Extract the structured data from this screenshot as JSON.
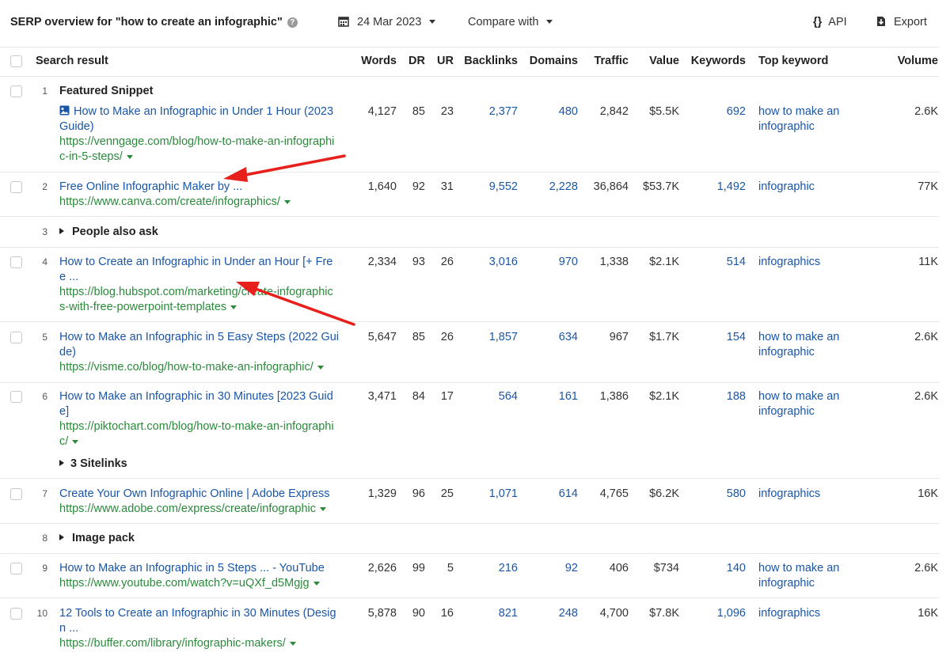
{
  "header": {
    "title": "SERP overview for \"how to create an infographic\"",
    "help_icon": "?",
    "date": "24 Mar 2023",
    "compare": "Compare with",
    "api": "API",
    "export": "Export"
  },
  "columns": {
    "search_result": "Search result",
    "words": "Words",
    "dr": "DR",
    "ur": "UR",
    "backlinks": "Backlinks",
    "domains": "Domains",
    "traffic": "Traffic",
    "value": "Value",
    "keywords": "Keywords",
    "top_keyword": "Top keyword",
    "volume": "Volume"
  },
  "rows": [
    {
      "rank": "1",
      "label": "Featured Snippet",
      "title1": "How to Make an Infographic in Under 1 Hour (2023",
      "title2": "Guide)",
      "url1": "https://venngage.com/blog/how-to-make-an-infographi",
      "url2": "c-in-5-steps/",
      "words": "4,127",
      "dr": "85",
      "ur": "23",
      "backlinks": "2,377",
      "domains": "480",
      "traffic": "2,842",
      "value": "$5.5K",
      "keywords": "692",
      "kw1": "how to make an",
      "kw2": "infographic",
      "volume": "2.6K"
    },
    {
      "rank": "2",
      "title1": "Free Online Infographic Maker by ...",
      "url1": "https://www.canva.com/create/infographics/",
      "words": "1,640",
      "dr": "92",
      "ur": "31",
      "backlinks": "9,552",
      "domains": "2,228",
      "traffic": "36,864",
      "value": "$53.7K",
      "keywords": "1,492",
      "kw1": "infographic",
      "volume": "77K"
    },
    {
      "rank": "3",
      "label": "People also ask"
    },
    {
      "rank": "4",
      "title1": "How to Create an Infographic in Under an Hour [+ Fre",
      "title2": "e ...",
      "url1": "https://blog.hubspot.com/marketing/create-infographic",
      "url2": "s-with-free-powerpoint-templates",
      "words": "2,334",
      "dr": "93",
      "ur": "26",
      "backlinks": "3,016",
      "domains": "970",
      "traffic": "1,338",
      "value": "$2.1K",
      "keywords": "514",
      "kw1": "infographics",
      "volume": "11K"
    },
    {
      "rank": "5",
      "title1": "How to Make an Infographic in 5 Easy Steps (2022 Gui",
      "title2": "de)",
      "url1": "https://visme.co/blog/how-to-make-an-infographic/",
      "words": "5,647",
      "dr": "85",
      "ur": "26",
      "backlinks": "1,857",
      "domains": "634",
      "traffic": "967",
      "value": "$1.7K",
      "keywords": "154",
      "kw1": "how to make an",
      "kw2": "infographic",
      "volume": "2.6K"
    },
    {
      "rank": "6",
      "title1": "How to Make an Infographic in 30 Minutes [2023 Guid",
      "title2": "e]",
      "url1": "https://piktochart.com/blog/how-to-make-an-infographi",
      "url2": "c/",
      "sitelinks": "3 Sitelinks",
      "words": "3,471",
      "dr": "84",
      "ur": "17",
      "backlinks": "564",
      "domains": "161",
      "traffic": "1,386",
      "value": "$2.1K",
      "keywords": "188",
      "kw1": "how to make an",
      "kw2": "infographic",
      "volume": "2.6K"
    },
    {
      "rank": "7",
      "title1": "Create Your Own Infographic Online | Adobe Express",
      "url1": "https://www.adobe.com/express/create/infographic",
      "words": "1,329",
      "dr": "96",
      "ur": "25",
      "backlinks": "1,071",
      "domains": "614",
      "traffic": "4,765",
      "value": "$6.2K",
      "keywords": "580",
      "kw1": "infographics",
      "volume": "16K"
    },
    {
      "rank": "8",
      "label": "Image pack"
    },
    {
      "rank": "9",
      "title1": "How to Make an Infographic in 5 Steps ... - YouTube",
      "url1": "https://www.youtube.com/watch?v=uQXf_d5Mgjg",
      "words": "2,626",
      "dr": "99",
      "ur": "5",
      "backlinks": "216",
      "domains": "92",
      "traffic": "406",
      "value": "$734",
      "keywords": "140",
      "kw1": "how to make an",
      "kw2": "infographic",
      "volume": "2.6K"
    },
    {
      "rank": "10",
      "title1": "12 Tools to Create an Infographic in 30 Minutes (Desig",
      "title2": "n ...",
      "url1": "https://buffer.com/library/infographic-makers/",
      "words": "5,878",
      "dr": "90",
      "ur": "16",
      "backlinks": "821",
      "domains": "248",
      "traffic": "4,700",
      "value": "$7.8K",
      "keywords": "1,096",
      "kw1": "infographics",
      "volume": "16K"
    }
  ],
  "colors": {
    "link": "#1a56a8",
    "url": "#2a8a3a",
    "annotation_arrow": "#e8201c"
  }
}
